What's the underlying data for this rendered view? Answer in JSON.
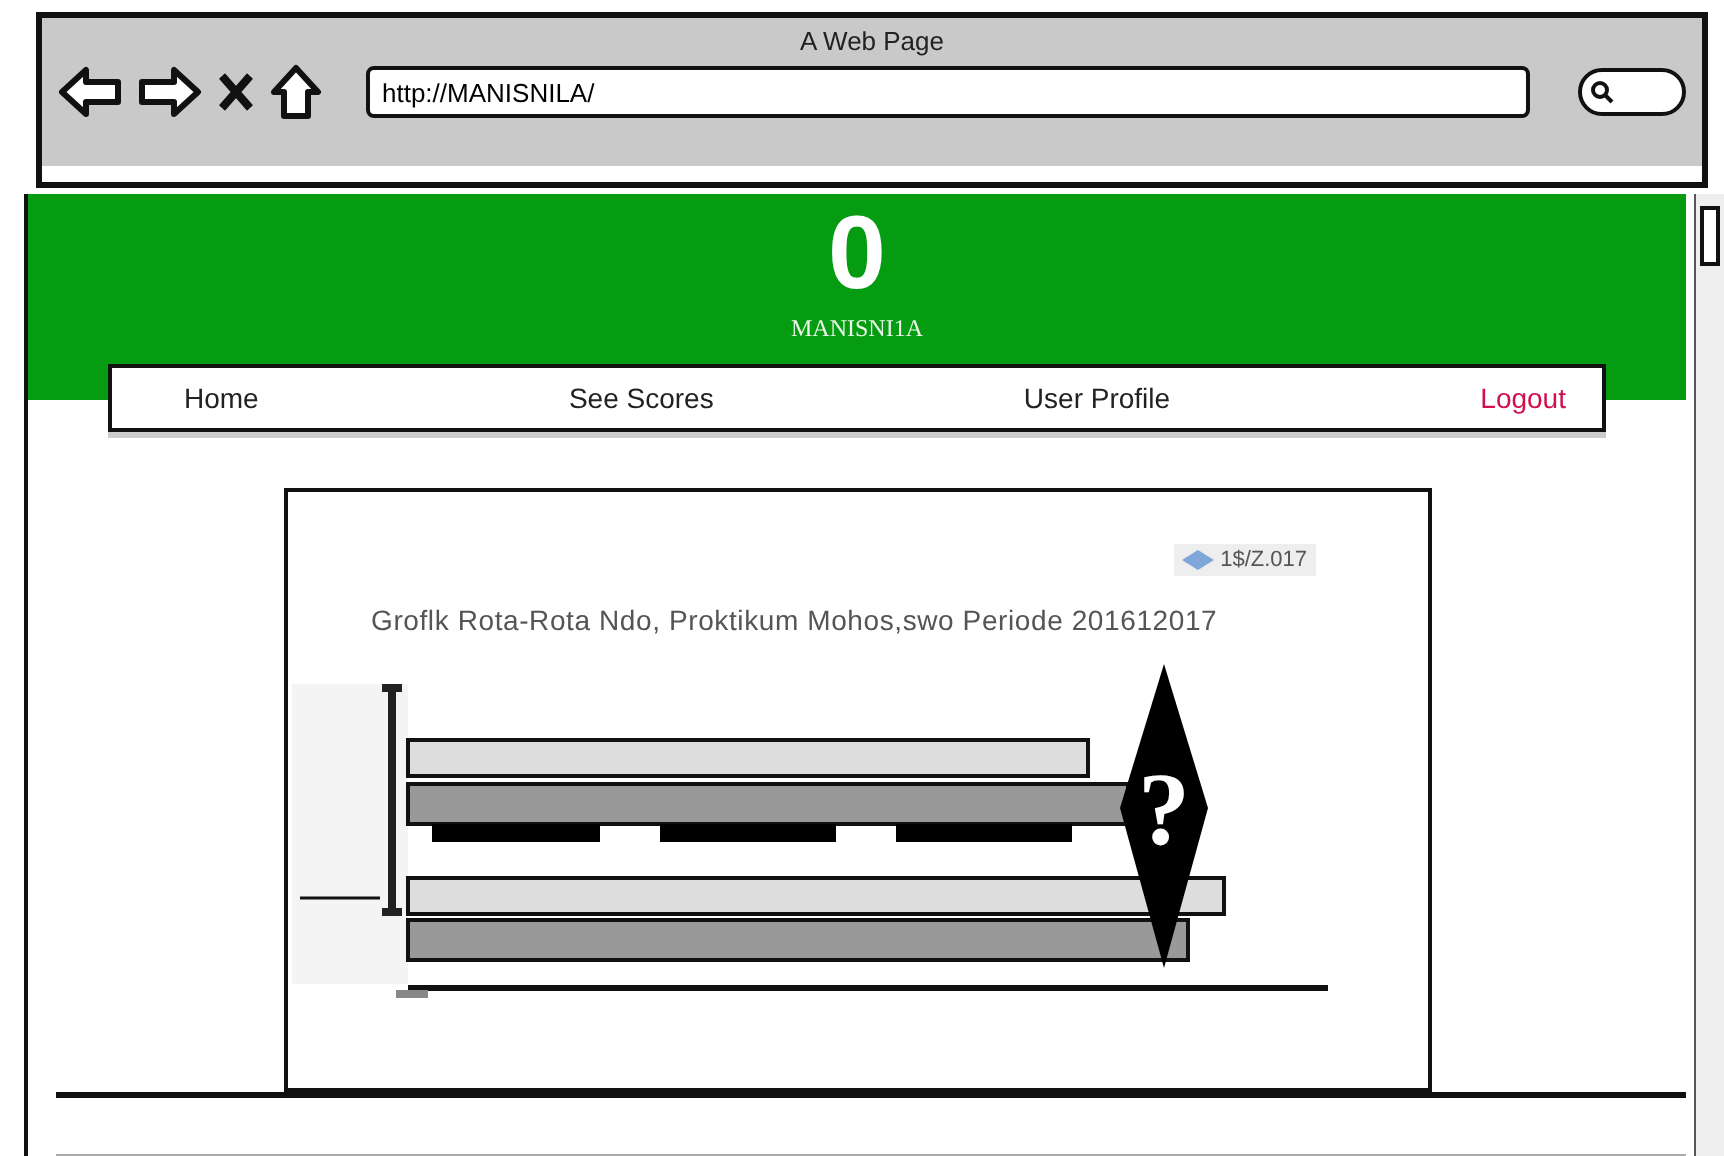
{
  "window": {
    "title": "A Web Page",
    "url": "http://MANISNILA/"
  },
  "header": {
    "logo": "0",
    "site_name": "MANISNI1A"
  },
  "nav": [
    {
      "label": "Home",
      "color": "#222222"
    },
    {
      "label": "See Scores",
      "color": "#222222"
    },
    {
      "label": "User Profile",
      "color": "#222222"
    },
    {
      "label": "Logout",
      "color": "#d0104c"
    }
  ],
  "card": {
    "badge": "1$/Z.017",
    "title": "Groflk Rota-Rota Ndo, Proktikum Mohos,swo Periode 201612017",
    "marker": "?"
  }
}
